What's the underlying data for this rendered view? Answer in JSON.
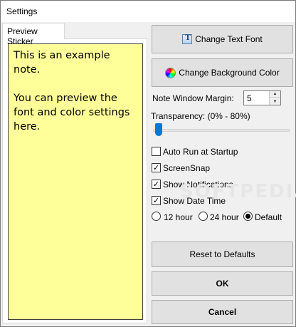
{
  "window": {
    "title": "Settings"
  },
  "tabs": [
    {
      "label": "Preview Sticker"
    }
  ],
  "sticker": {
    "line1": "This is an example note.",
    "line2": "You can preview the font and color settings here.",
    "background": "#ffff9a"
  },
  "buttons": {
    "change_text_font": "Change Text Font",
    "change_background_color": "Change Background Color",
    "reset_defaults": "Reset to Defaults",
    "ok": "OK",
    "cancel": "Cancel"
  },
  "margin": {
    "label": "Note Window Margin:",
    "value": "5"
  },
  "transparency": {
    "label": "Transparency: (0% - 80%)",
    "value_percent": 0
  },
  "checkboxes": [
    {
      "label": "Auto Run at Startup",
      "checked": false
    },
    {
      "label": "ScreenSnap",
      "checked": true
    },
    {
      "label": "Show Notifications",
      "checked": true
    },
    {
      "label": "Show Date Time",
      "checked": true
    }
  ],
  "time_format": {
    "options": [
      {
        "label": "12 hour",
        "selected": false
      },
      {
        "label": "24 hour",
        "selected": false
      },
      {
        "label": "Default",
        "selected": true
      }
    ]
  },
  "watermark": "SOFTPEDIA",
  "icons": {
    "font": "font-icon",
    "color": "color-wheel-icon"
  },
  "colors": {
    "slider_accent": "#0078d7"
  }
}
